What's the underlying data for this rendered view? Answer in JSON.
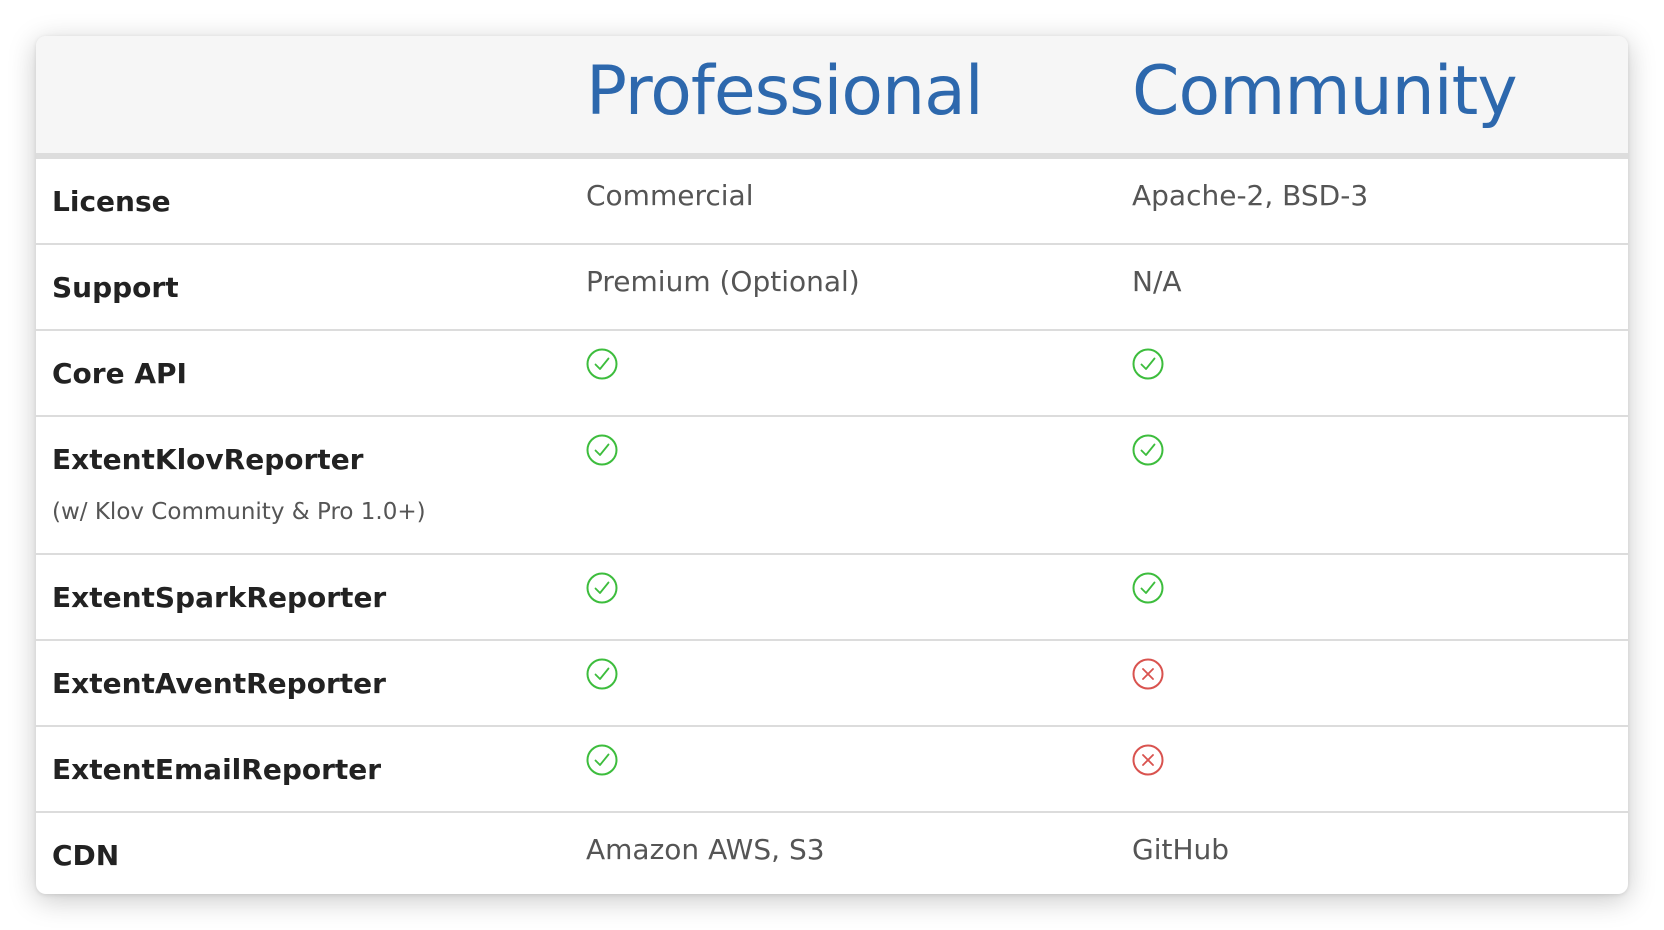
{
  "header": {
    "professional": "Professional",
    "community": "Community"
  },
  "rows": [
    {
      "feature": "License",
      "professional": "Commercial",
      "community": "Apache-2, BSD-3"
    },
    {
      "feature": "Support",
      "professional": "Premium (Optional)",
      "community": "N/A"
    },
    {
      "feature": "Core API",
      "professional": "check-icon",
      "community": "check-icon"
    },
    {
      "feature": "ExtentKlovReporter",
      "note": "(w/ Klov Community & Pro 1.0+)",
      "professional": "check-icon",
      "community": "check-icon"
    },
    {
      "feature": "ExtentSparkReporter",
      "professional": "check-icon",
      "community": "check-icon"
    },
    {
      "feature": "ExtentAventReporter",
      "professional": "check-icon",
      "community": "cross-icon"
    },
    {
      "feature": "ExtentEmailReporter",
      "professional": "check-icon",
      "community": "cross-icon"
    },
    {
      "feature": "CDN",
      "professional": "Amazon AWS, S3",
      "community": "GitHub"
    }
  ],
  "colors": {
    "title": "#2d68ad",
    "check": "#3dbd3d",
    "cross": "#d9534f"
  }
}
